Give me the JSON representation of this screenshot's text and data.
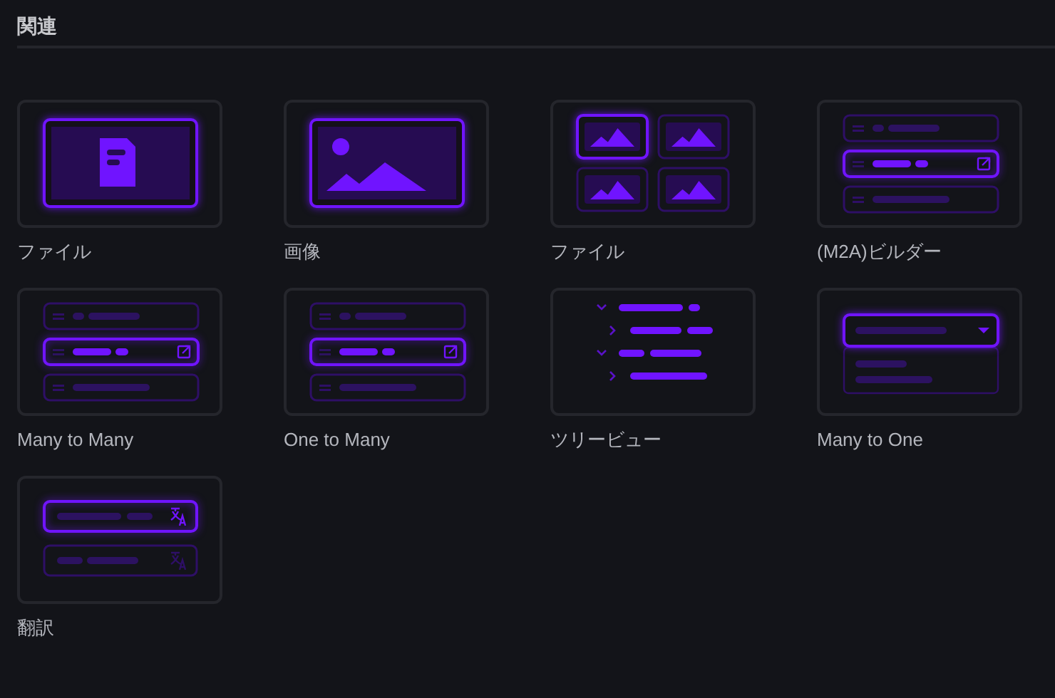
{
  "section": {
    "title": "関連"
  },
  "interfaces": [
    {
      "kind": "file",
      "label": "ファイル"
    },
    {
      "kind": "image",
      "label": "画像"
    },
    {
      "kind": "files",
      "label": "ファイル"
    },
    {
      "kind": "builder",
      "label": "(M2A)ビルダー"
    },
    {
      "kind": "list",
      "label": "Many to Many"
    },
    {
      "kind": "list",
      "label": "One to Many"
    },
    {
      "kind": "tree",
      "label": "ツリービュー"
    },
    {
      "kind": "select",
      "label": "Many to One"
    },
    {
      "kind": "translations",
      "label": "翻訳"
    }
  ]
}
